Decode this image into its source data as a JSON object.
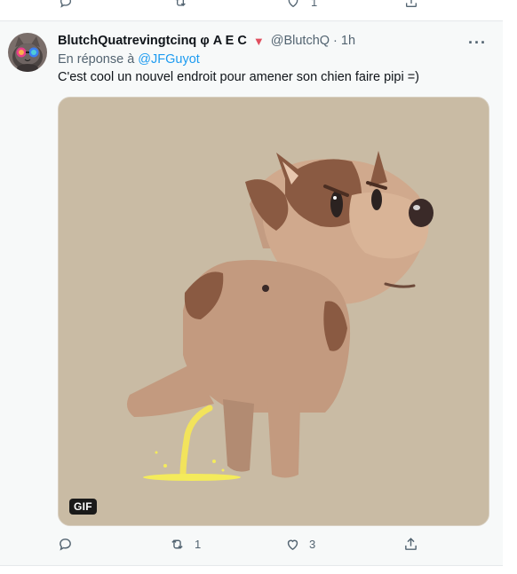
{
  "prev_tweet": {
    "retweet_count": "",
    "like_count": "1"
  },
  "tweet": {
    "display_name": "BlutchQuatrevingtcinq φ A E C",
    "handle": "@BlutchQ",
    "separator": "·",
    "time": "1h",
    "more_label": "···",
    "reply_prefix": "En réponse à",
    "reply_to": "@JFGuyot",
    "text": "C'est cool un nouvel endroit pour amener son chien faire pipi =)",
    "media_badge": "GIF",
    "reply_count": "",
    "retweet_count": "1",
    "like_count": "3",
    "share_count": ""
  },
  "icons": {
    "flag": "triangle-flag-icon",
    "reply": "reply-icon",
    "retweet": "retweet-icon",
    "like": "heart-icon",
    "share": "share-icon",
    "more": "more-icon"
  },
  "colors": {
    "link": "#1d9bf0",
    "muted": "#536471",
    "flag": "#e04f5f",
    "media_bg": "#c9bba4"
  }
}
